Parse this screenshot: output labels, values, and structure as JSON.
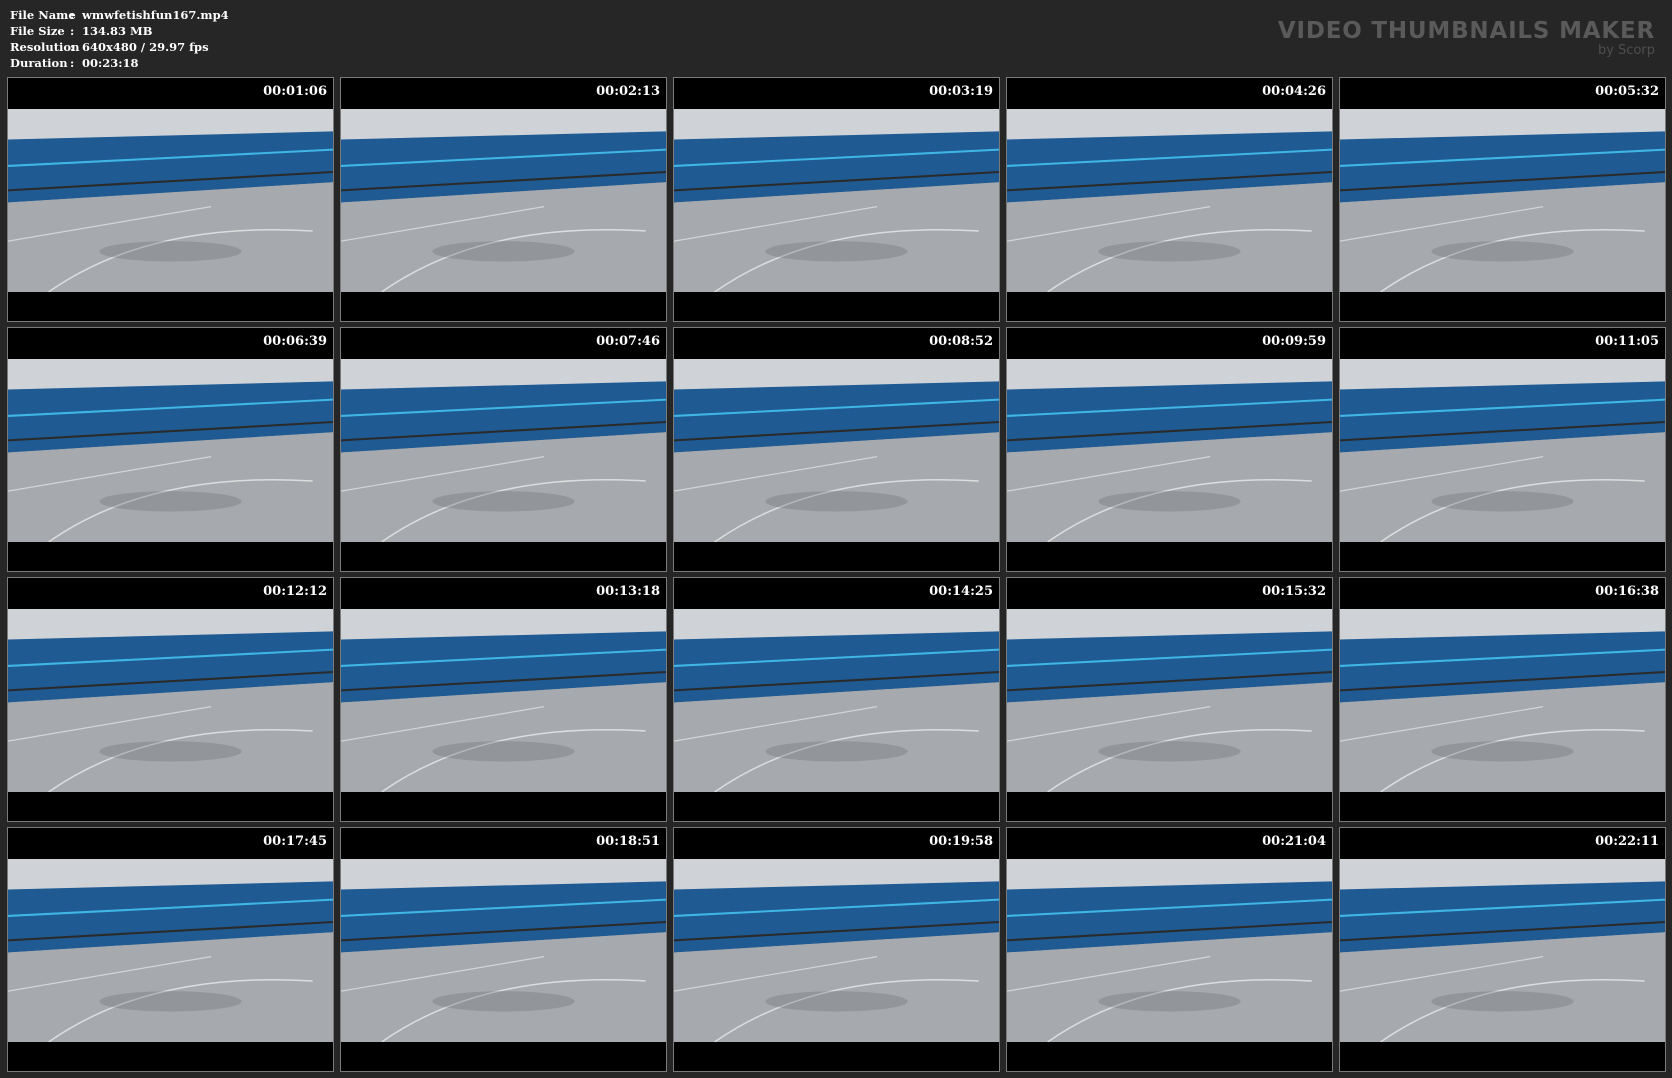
{
  "file_info": [
    {
      "label": "File Name",
      "value": "wmwfetishfun167.mp4"
    },
    {
      "label": "File Size",
      "value": "134.83 MB"
    },
    {
      "label": "Resolution",
      "value": "640x480 / 29.97 fps"
    },
    {
      "label": "Duration",
      "value": "00:23:18"
    }
  ],
  "brand": {
    "title": "VIDEO THUMBNAILS MAKER",
    "subtitle": "by Scorp"
  },
  "thumbnails": [
    {
      "timestamp": "00:01:06"
    },
    {
      "timestamp": "00:02:13"
    },
    {
      "timestamp": "00:03:19"
    },
    {
      "timestamp": "00:04:26"
    },
    {
      "timestamp": "00:05:32"
    },
    {
      "timestamp": "00:06:39"
    },
    {
      "timestamp": "00:07:46"
    },
    {
      "timestamp": "00:08:52"
    },
    {
      "timestamp": "00:09:59"
    },
    {
      "timestamp": "00:11:05"
    },
    {
      "timestamp": "00:12:12"
    },
    {
      "timestamp": "00:13:18"
    },
    {
      "timestamp": "00:14:25"
    },
    {
      "timestamp": "00:15:32"
    },
    {
      "timestamp": "00:16:38"
    },
    {
      "timestamp": "00:17:45"
    },
    {
      "timestamp": "00:18:51"
    },
    {
      "timestamp": "00:19:58"
    },
    {
      "timestamp": "00:21:04"
    },
    {
      "timestamp": "00:22:11"
    }
  ]
}
